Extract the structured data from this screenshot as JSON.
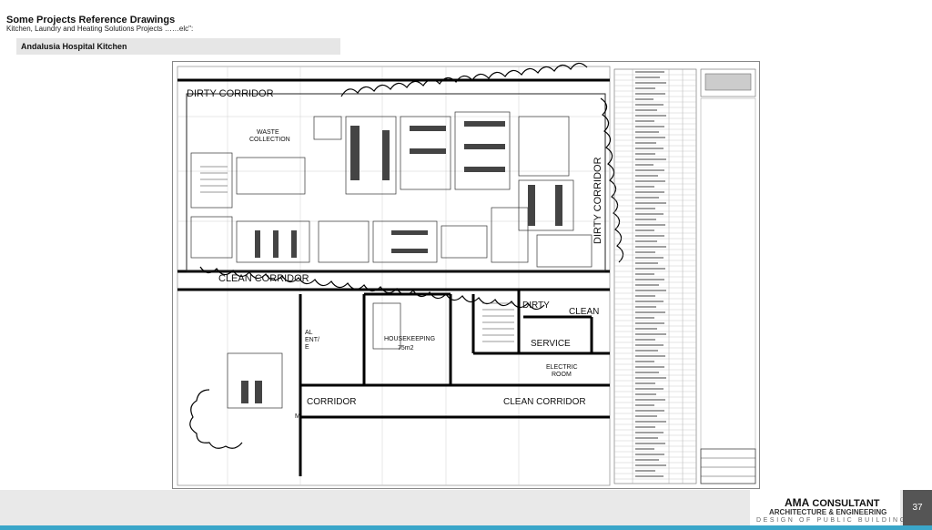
{
  "header": {
    "title": "Some Projects Reference Drawings",
    "subtitle": "Kitchen, Laundry and Heating Solutions Projects ……elc\":"
  },
  "banner": {
    "label": "Andalusia Hospital Kitchen"
  },
  "drawing": {
    "labels": {
      "dirty_corridor_top": "DIRTY CORRIDOR",
      "waste_collection": "WASTE",
      "waste_collection_2": "COLLECTION",
      "clean_corridor_mid": "CLEAN CORRIDOR",
      "dirty_corridor_right": "DIRTY CORRIDOR",
      "dirty": "DIRTY",
      "clean": "CLEAN",
      "service": "SERVICE",
      "electric": "ELECTRIC",
      "room": "ROOM",
      "housekeeping": "HOUSEKEEPING",
      "housekeeping_area": "75m2",
      "corridor": "CORRIDOR",
      "clean_corridor_bottom": "CLEAN CORRIDOR",
      "partial_al": "AL",
      "partial_ent": "ENT/",
      "partial_e": "E",
      "partial_m": "M"
    }
  },
  "footer": {
    "brand_bold": "AMA",
    "brand_rest": " CONSULTANT",
    "brand_sub": "ARCHITECTURE & ENGINEERING",
    "tagline": "DESIGN OF PUBLIC BUILDINGS",
    "page_number": "37",
    "accent_color": "#3aa6c9"
  }
}
